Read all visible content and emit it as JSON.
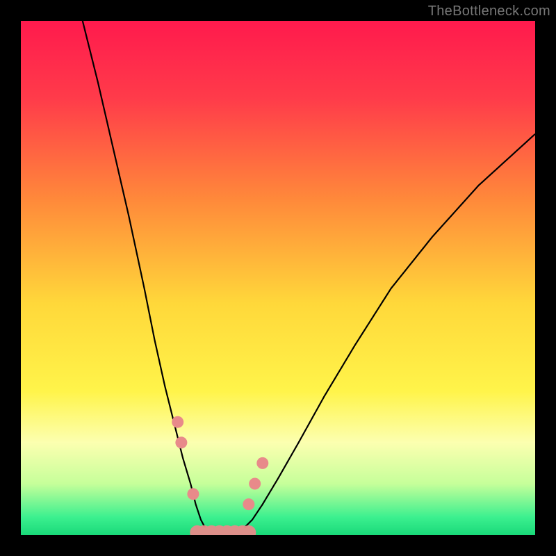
{
  "watermark": "TheBottleneck.com",
  "chart_data": {
    "type": "line",
    "title": "",
    "xlabel": "",
    "ylabel": "",
    "xlim": [
      0,
      100
    ],
    "ylim": [
      0,
      100
    ],
    "background_gradient": {
      "stops": [
        {
          "offset": 0,
          "color": "#ff1a4d"
        },
        {
          "offset": 0.15,
          "color": "#ff3b4a"
        },
        {
          "offset": 0.35,
          "color": "#ff8a3a"
        },
        {
          "offset": 0.55,
          "color": "#ffd83a"
        },
        {
          "offset": 0.72,
          "color": "#fff44a"
        },
        {
          "offset": 0.82,
          "color": "#fcffb0"
        },
        {
          "offset": 0.9,
          "color": "#c6ff9a"
        },
        {
          "offset": 0.965,
          "color": "#3cf08f"
        },
        {
          "offset": 1.0,
          "color": "#19d979"
        }
      ]
    },
    "series": [
      {
        "name": "left-curve",
        "x": [
          12,
          15,
          18,
          21,
          24,
          26,
          28,
          30,
          31.5,
          33,
          34,
          35,
          35.8
        ],
        "y": [
          100,
          88,
          75,
          62,
          48,
          38,
          29,
          21,
          15,
          10,
          6,
          3,
          1.5
        ]
      },
      {
        "name": "right-curve",
        "x": [
          43.5,
          45,
          47,
          50,
          54,
          59,
          65,
          72,
          80,
          89,
          100
        ],
        "y": [
          1.5,
          3,
          6,
          11,
          18,
          27,
          37,
          48,
          58,
          68,
          78
        ]
      }
    ],
    "markers": {
      "left_cluster": [
        {
          "x": 30.5,
          "y": 22
        },
        {
          "x": 31.2,
          "y": 18
        },
        {
          "x": 33.5,
          "y": 8
        }
      ],
      "bottom_lumps_x": [
        34.3,
        35.6,
        37.1,
        38.6,
        40.1,
        41.6,
        43.1,
        44.3
      ],
      "right_cluster": [
        {
          "x": 44.3,
          "y": 6
        },
        {
          "x": 45.5,
          "y": 10
        },
        {
          "x": 47.0,
          "y": 14
        }
      ]
    },
    "marker_color": "#e88a8a",
    "curve_color": "#000000"
  }
}
